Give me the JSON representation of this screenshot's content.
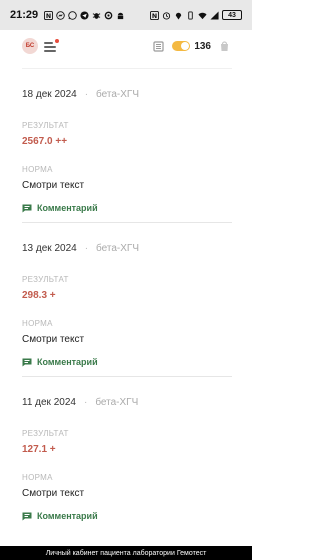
{
  "status_bar": {
    "time": "21:29",
    "battery": "43"
  },
  "header": {
    "avatar_initials": "БС",
    "coins": "136"
  },
  "labels": {
    "result": "РЕЗУЛЬТАТ",
    "norm": "НОРМА",
    "comment": "Комментарий"
  },
  "results": [
    {
      "date": "18 дек 2024",
      "test": "бета-ХГЧ",
      "value": "2567.0 ++",
      "norm": "Смотри текст"
    },
    {
      "date": "13 дек 2024",
      "test": "бета-ХГЧ",
      "value": "298.3 +",
      "norm": "Смотри текст"
    },
    {
      "date": "11 дек 2024",
      "test": "бета-ХГЧ",
      "value": "127.1 +",
      "norm": "Смотри текст"
    }
  ],
  "footer": {
    "text": "Личный кабинет пациента лаборатории Гемотест"
  },
  "colors": {
    "result_value": "#c25b4d",
    "comment_link": "#3a7a4a",
    "accent_coins": "#f4b942"
  }
}
